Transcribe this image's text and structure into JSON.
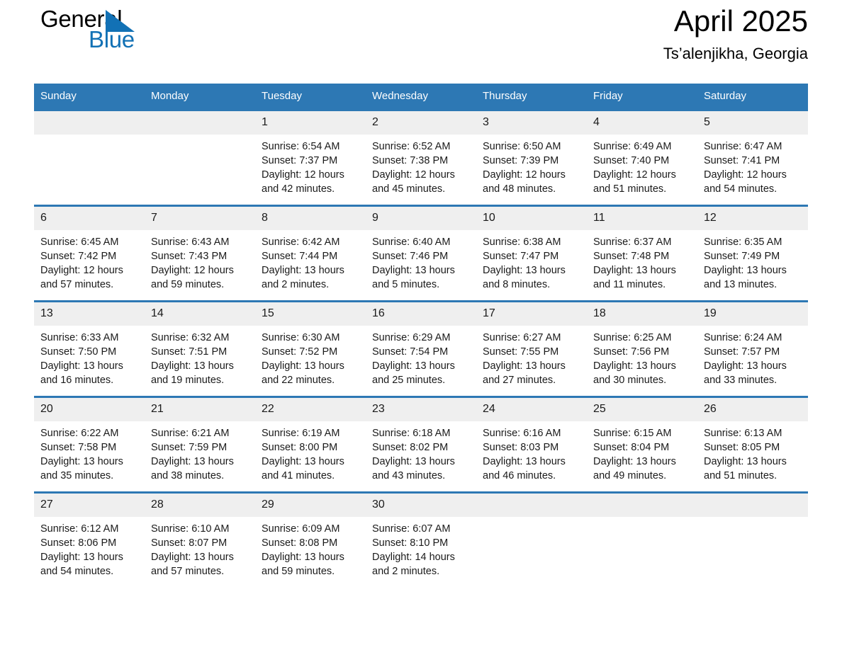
{
  "brand": {
    "line1": "General",
    "line2": "Blue",
    "triangle_color": "#1271b5"
  },
  "header": {
    "title": "April 2025",
    "subtitle": "Ts’alenjikha, Georgia",
    "header_bg": "#2d78b4",
    "date_band_bg": "#efefef"
  },
  "weekday_headers": [
    "Sunday",
    "Monday",
    "Tuesday",
    "Wednesday",
    "Thursday",
    "Friday",
    "Saturday"
  ],
  "labels": {
    "sunrise_prefix": "Sunrise:",
    "sunset_prefix": "Sunset:",
    "daylight_prefix": "Daylight:"
  },
  "weeks": [
    [
      {
        "day": "",
        "empty": true
      },
      {
        "day": "",
        "empty": true
      },
      {
        "day": "1",
        "sunrise": "Sunrise: 6:54 AM",
        "sunset": "Sunset: 7:37 PM",
        "daylight_line1": "Daylight: 12 hours",
        "daylight_line2": "and 42 minutes."
      },
      {
        "day": "2",
        "sunrise": "Sunrise: 6:52 AM",
        "sunset": "Sunset: 7:38 PM",
        "daylight_line1": "Daylight: 12 hours",
        "daylight_line2": "and 45 minutes."
      },
      {
        "day": "3",
        "sunrise": "Sunrise: 6:50 AM",
        "sunset": "Sunset: 7:39 PM",
        "daylight_line1": "Daylight: 12 hours",
        "daylight_line2": "and 48 minutes."
      },
      {
        "day": "4",
        "sunrise": "Sunrise: 6:49 AM",
        "sunset": "Sunset: 7:40 PM",
        "daylight_line1": "Daylight: 12 hours",
        "daylight_line2": "and 51 minutes."
      },
      {
        "day": "5",
        "sunrise": "Sunrise: 6:47 AM",
        "sunset": "Sunset: 7:41 PM",
        "daylight_line1": "Daylight: 12 hours",
        "daylight_line2": "and 54 minutes."
      }
    ],
    [
      {
        "day": "6",
        "sunrise": "Sunrise: 6:45 AM",
        "sunset": "Sunset: 7:42 PM",
        "daylight_line1": "Daylight: 12 hours",
        "daylight_line2": "and 57 minutes."
      },
      {
        "day": "7",
        "sunrise": "Sunrise: 6:43 AM",
        "sunset": "Sunset: 7:43 PM",
        "daylight_line1": "Daylight: 12 hours",
        "daylight_line2": "and 59 minutes."
      },
      {
        "day": "8",
        "sunrise": "Sunrise: 6:42 AM",
        "sunset": "Sunset: 7:44 PM",
        "daylight_line1": "Daylight: 13 hours",
        "daylight_line2": "and 2 minutes."
      },
      {
        "day": "9",
        "sunrise": "Sunrise: 6:40 AM",
        "sunset": "Sunset: 7:46 PM",
        "daylight_line1": "Daylight: 13 hours",
        "daylight_line2": "and 5 minutes."
      },
      {
        "day": "10",
        "sunrise": "Sunrise: 6:38 AM",
        "sunset": "Sunset: 7:47 PM",
        "daylight_line1": "Daylight: 13 hours",
        "daylight_line2": "and 8 minutes."
      },
      {
        "day": "11",
        "sunrise": "Sunrise: 6:37 AM",
        "sunset": "Sunset: 7:48 PM",
        "daylight_line1": "Daylight: 13 hours",
        "daylight_line2": "and 11 minutes."
      },
      {
        "day": "12",
        "sunrise": "Sunrise: 6:35 AM",
        "sunset": "Sunset: 7:49 PM",
        "daylight_line1": "Daylight: 13 hours",
        "daylight_line2": "and 13 minutes."
      }
    ],
    [
      {
        "day": "13",
        "sunrise": "Sunrise: 6:33 AM",
        "sunset": "Sunset: 7:50 PM",
        "daylight_line1": "Daylight: 13 hours",
        "daylight_line2": "and 16 minutes."
      },
      {
        "day": "14",
        "sunrise": "Sunrise: 6:32 AM",
        "sunset": "Sunset: 7:51 PM",
        "daylight_line1": "Daylight: 13 hours",
        "daylight_line2": "and 19 minutes."
      },
      {
        "day": "15",
        "sunrise": "Sunrise: 6:30 AM",
        "sunset": "Sunset: 7:52 PM",
        "daylight_line1": "Daylight: 13 hours",
        "daylight_line2": "and 22 minutes."
      },
      {
        "day": "16",
        "sunrise": "Sunrise: 6:29 AM",
        "sunset": "Sunset: 7:54 PM",
        "daylight_line1": "Daylight: 13 hours",
        "daylight_line2": "and 25 minutes."
      },
      {
        "day": "17",
        "sunrise": "Sunrise: 6:27 AM",
        "sunset": "Sunset: 7:55 PM",
        "daylight_line1": "Daylight: 13 hours",
        "daylight_line2": "and 27 minutes."
      },
      {
        "day": "18",
        "sunrise": "Sunrise: 6:25 AM",
        "sunset": "Sunset: 7:56 PM",
        "daylight_line1": "Daylight: 13 hours",
        "daylight_line2": "and 30 minutes."
      },
      {
        "day": "19",
        "sunrise": "Sunrise: 6:24 AM",
        "sunset": "Sunset: 7:57 PM",
        "daylight_line1": "Daylight: 13 hours",
        "daylight_line2": "and 33 minutes."
      }
    ],
    [
      {
        "day": "20",
        "sunrise": "Sunrise: 6:22 AM",
        "sunset": "Sunset: 7:58 PM",
        "daylight_line1": "Daylight: 13 hours",
        "daylight_line2": "and 35 minutes."
      },
      {
        "day": "21",
        "sunrise": "Sunrise: 6:21 AM",
        "sunset": "Sunset: 7:59 PM",
        "daylight_line1": "Daylight: 13 hours",
        "daylight_line2": "and 38 minutes."
      },
      {
        "day": "22",
        "sunrise": "Sunrise: 6:19 AM",
        "sunset": "Sunset: 8:00 PM",
        "daylight_line1": "Daylight: 13 hours",
        "daylight_line2": "and 41 minutes."
      },
      {
        "day": "23",
        "sunrise": "Sunrise: 6:18 AM",
        "sunset": "Sunset: 8:02 PM",
        "daylight_line1": "Daylight: 13 hours",
        "daylight_line2": "and 43 minutes."
      },
      {
        "day": "24",
        "sunrise": "Sunrise: 6:16 AM",
        "sunset": "Sunset: 8:03 PM",
        "daylight_line1": "Daylight: 13 hours",
        "daylight_line2": "and 46 minutes."
      },
      {
        "day": "25",
        "sunrise": "Sunrise: 6:15 AM",
        "sunset": "Sunset: 8:04 PM",
        "daylight_line1": "Daylight: 13 hours",
        "daylight_line2": "and 49 minutes."
      },
      {
        "day": "26",
        "sunrise": "Sunrise: 6:13 AM",
        "sunset": "Sunset: 8:05 PM",
        "daylight_line1": "Daylight: 13 hours",
        "daylight_line2": "and 51 minutes."
      }
    ],
    [
      {
        "day": "27",
        "sunrise": "Sunrise: 6:12 AM",
        "sunset": "Sunset: 8:06 PM",
        "daylight_line1": "Daylight: 13 hours",
        "daylight_line2": "and 54 minutes."
      },
      {
        "day": "28",
        "sunrise": "Sunrise: 6:10 AM",
        "sunset": "Sunset: 8:07 PM",
        "daylight_line1": "Daylight: 13 hours",
        "daylight_line2": "and 57 minutes."
      },
      {
        "day": "29",
        "sunrise": "Sunrise: 6:09 AM",
        "sunset": "Sunset: 8:08 PM",
        "daylight_line1": "Daylight: 13 hours",
        "daylight_line2": "and 59 minutes."
      },
      {
        "day": "30",
        "sunrise": "Sunrise: 6:07 AM",
        "sunset": "Sunset: 8:10 PM",
        "daylight_line1": "Daylight: 14 hours",
        "daylight_line2": "and 2 minutes."
      },
      {
        "day": "",
        "empty": true
      },
      {
        "day": "",
        "empty": true
      },
      {
        "day": "",
        "empty": true
      }
    ]
  ]
}
